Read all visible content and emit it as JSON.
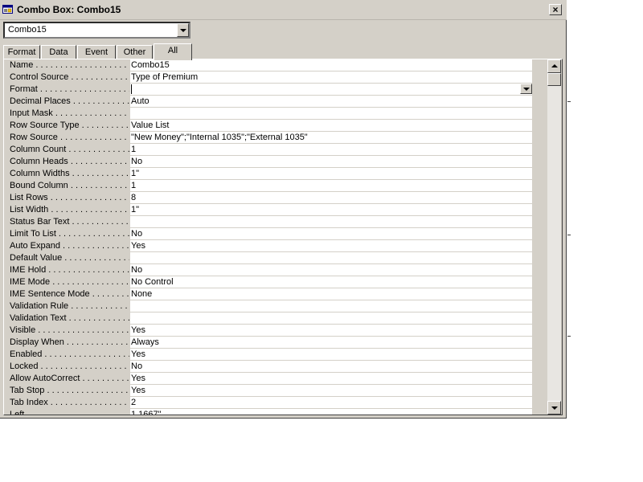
{
  "window": {
    "title": "Combo Box: Combo15",
    "close_label": "×"
  },
  "object_selector": {
    "value": "Combo15"
  },
  "tabs": [
    {
      "label": "Format"
    },
    {
      "label": "Data"
    },
    {
      "label": "Event"
    },
    {
      "label": "Other"
    },
    {
      "label": "All",
      "active": true
    }
  ],
  "properties": [
    {
      "label": "Name",
      "value": "Combo15"
    },
    {
      "label": "Control Source",
      "value": "Type of Premium"
    },
    {
      "label": "Format",
      "value": ""
    },
    {
      "label": "Decimal Places",
      "value": "Auto"
    },
    {
      "label": "Input Mask",
      "value": ""
    },
    {
      "label": "Row Source Type",
      "value": "Value List"
    },
    {
      "label": "Row Source",
      "value": "\"New Money\";\"Internal 1035\";\"External 1035\""
    },
    {
      "label": "Column Count",
      "value": "1"
    },
    {
      "label": "Column Heads",
      "value": "No"
    },
    {
      "label": "Column Widths",
      "value": "1\""
    },
    {
      "label": "Bound Column",
      "value": "1"
    },
    {
      "label": "List Rows",
      "value": "8"
    },
    {
      "label": "List Width",
      "value": "1\""
    },
    {
      "label": "Status Bar Text",
      "value": ""
    },
    {
      "label": "Limit To List",
      "value": "No"
    },
    {
      "label": "Auto Expand",
      "value": "Yes"
    },
    {
      "label": "Default Value",
      "value": ""
    },
    {
      "label": "IME Hold",
      "value": "No"
    },
    {
      "label": "IME Mode",
      "value": "No Control"
    },
    {
      "label": "IME Sentence Mode",
      "value": "None"
    },
    {
      "label": "Validation Rule",
      "value": ""
    },
    {
      "label": "Validation Text",
      "value": ""
    },
    {
      "label": "Visible",
      "value": "Yes"
    },
    {
      "label": "Display When",
      "value": "Always"
    },
    {
      "label": "Enabled",
      "value": "Yes"
    },
    {
      "label": "Locked",
      "value": "No"
    },
    {
      "label": "Allow AutoCorrect",
      "value": "Yes"
    },
    {
      "label": "Tab Stop",
      "value": "Yes"
    },
    {
      "label": "Tab Index",
      "value": "2"
    },
    {
      "label": "Left",
      "value": "1.1667\""
    }
  ],
  "colors": {
    "face": "#d4d0c8",
    "field": "#ffffff"
  },
  "icons": {
    "title": "properties-sheet-icon",
    "close": "close-icon"
  }
}
